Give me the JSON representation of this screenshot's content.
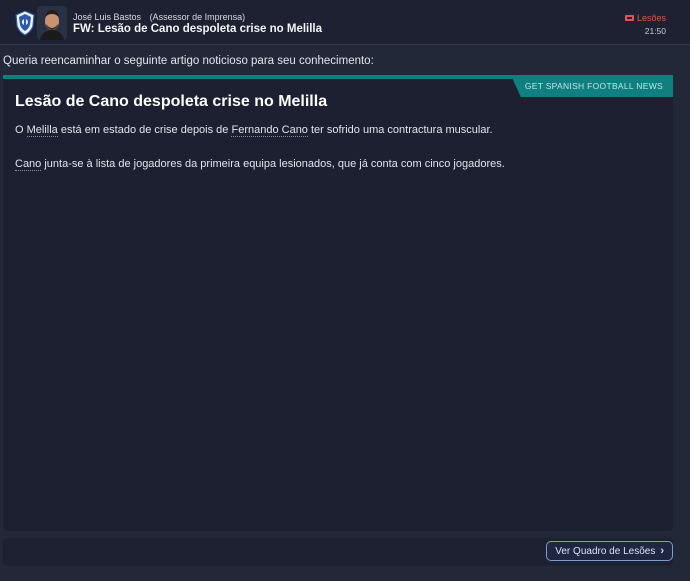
{
  "header": {
    "sender_name": "José Luis Bastos",
    "sender_role": "(Assessor de Imprensa)",
    "subject": "FW: Lesão de Cano despoleta crise no Melilla",
    "tag_label": "Lesões",
    "time": "21:50",
    "tag_color": "#e2545a"
  },
  "message": {
    "intro": "Queria reencaminhar o seguinte artigo noticioso para seu conhecimento:"
  },
  "article": {
    "source": "GET SPANISH FOOTBALL NEWS",
    "headline": "Lesão de Cano despoleta crise no Melilla",
    "p1_a": "O ",
    "p1_link1": "Melilla",
    "p1_b": " está em estado de crise depois de ",
    "p1_link2": "Fernando Cano",
    "p1_c": " ter sofrido uma contractura muscular.",
    "p2_link": "Cano",
    "p2_rest": " junta-se à lista de jogadores da primeira equipa lesionados, que já conta com cinco jogadores.",
    "accent_color": "#0f7f7f"
  },
  "footer": {
    "button_label": "Ver Quadro de Lesões"
  },
  "icons": {
    "crest": "club-crest-icon",
    "avatar": "person-avatar",
    "tag": "injury-tag-icon",
    "chevron": "chevron-right-icon"
  }
}
